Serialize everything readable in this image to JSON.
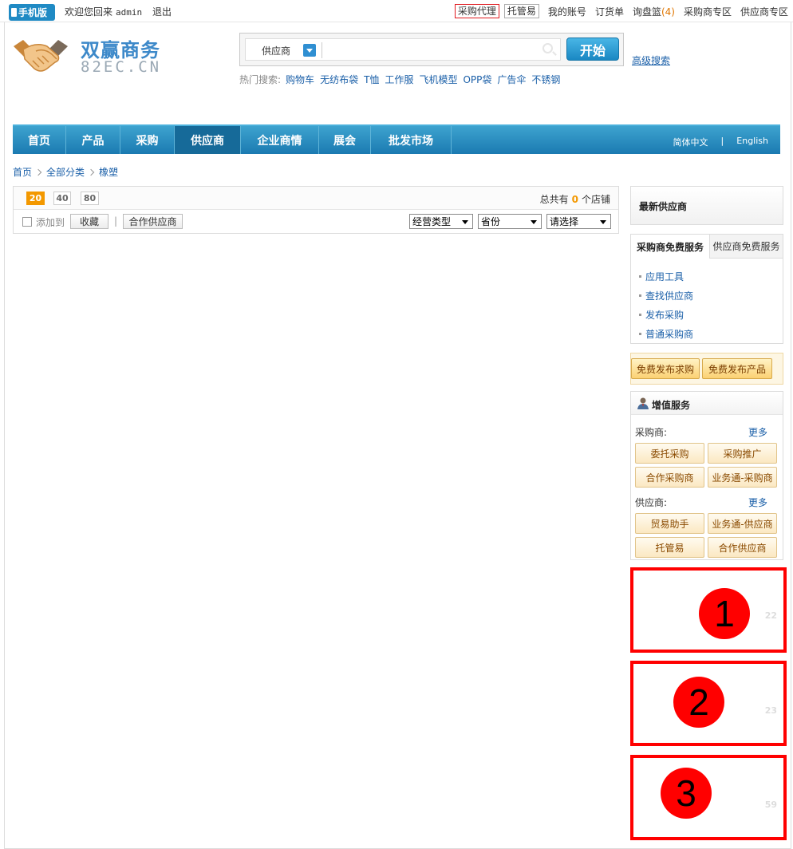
{
  "topbar": {
    "mobile_label": "手机版",
    "welcome": "欢迎您回来",
    "username": "admin",
    "logout": "退出",
    "nav": [
      {
        "label": "采购代理",
        "style": "boxed-red"
      },
      {
        "label": "托管易",
        "style": "boxed-grey"
      },
      {
        "label": "我的账号",
        "style": "plain"
      },
      {
        "label": "订货单",
        "style": "plain"
      },
      {
        "label": "询盘篮",
        "style": "plain",
        "count": "(4)"
      },
      {
        "label": "采购商专区",
        "style": "plain"
      },
      {
        "label": "供应商专区",
        "style": "plain"
      }
    ]
  },
  "logo": {
    "cn": "双赢商务",
    "en": "82EC.CN"
  },
  "search": {
    "type_label": "供应商",
    "button": "开始",
    "advanced": "高级搜索",
    "hot_label": "热门搜索:",
    "hot_items": [
      "购物车",
      "无纺布袋",
      "T恤",
      "工作服",
      "飞机模型",
      "OPP袋",
      "广告伞",
      "不锈钢"
    ]
  },
  "mainnav": {
    "items": [
      "首页",
      "产品",
      "采购",
      "供应商",
      "企业商情",
      "展会",
      "批发市场"
    ],
    "active": "供应商",
    "lang_cn": "简体中文",
    "lang_sep": "|",
    "lang_en": "English"
  },
  "breadcrumb": [
    "首页",
    "全部分类",
    "橡塑"
  ],
  "filter": {
    "page_sizes": [
      "20",
      "40",
      "80"
    ],
    "active_page_size": "20",
    "total_prefix": "总共有",
    "total_count": "0",
    "total_suffix": "个店铺",
    "add_to": "添加到",
    "favorite": "收藏",
    "divider": "|",
    "partner": "合作供应商",
    "selects": [
      "经营类型",
      "省份",
      "请选择"
    ]
  },
  "sidebar": {
    "latest_title": "最新供应商",
    "tabs": [
      "采购商免费服务",
      "供应商免费服务"
    ],
    "service_items": [
      "应用工具",
      "查找供应商",
      "发布采购",
      "普通采购商"
    ],
    "free_buttons": [
      "免费发布求购",
      "免费发布产品"
    ],
    "vas": {
      "title": "增值服务",
      "buyer_label": "采购商:",
      "supplier_label": "供应商:",
      "more": "更多",
      "buyer_buttons": [
        "委托采购",
        "采购推广",
        "合作采购商",
        "业务通-采购商"
      ],
      "supplier_buttons": [
        "贸易助手",
        "业务通-供应商",
        "托管易",
        "合作供应商"
      ]
    }
  },
  "ads": [
    {
      "circle": "1",
      "num": "22"
    },
    {
      "circle": "2",
      "num": "23"
    },
    {
      "circle": "3",
      "num": "59"
    }
  ],
  "colors": {
    "accent": "#1b7ab1",
    "highlight": "#f39800",
    "ad_border": "#ff0000"
  }
}
